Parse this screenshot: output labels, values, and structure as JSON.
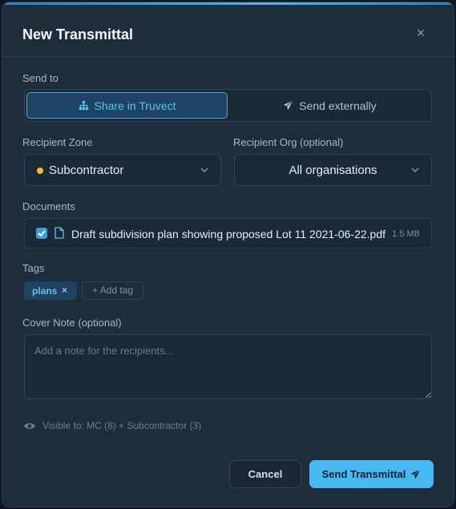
{
  "dialog": {
    "title": "New Transmittal",
    "close_glyph": "×"
  },
  "send_to": {
    "label": "Send to",
    "options": [
      {
        "label": "Share in Truvect",
        "icon": "sitemap-icon",
        "selected": true
      },
      {
        "label": "Send externally",
        "icon": "paper-plane-icon",
        "selected": false
      }
    ]
  },
  "recipient_zone": {
    "label": "Recipient Zone",
    "value": "Subcontractor",
    "dot_color": "#f5c02b"
  },
  "recipient_org": {
    "label": "Recipient Org (optional)",
    "value": "All organisations"
  },
  "documents": {
    "label": "Documents",
    "items": [
      {
        "name": "Draft subdivision plan showing proposed Lot 11 2021-06-22.pdf",
        "size": "1.5 MB",
        "checked": true
      }
    ]
  },
  "tags": {
    "label": "Tags",
    "items": [
      {
        "label": "plans",
        "remove_glyph": "×"
      }
    ],
    "add_label": "+ Add tag"
  },
  "cover_note": {
    "label": "Cover Note (optional)",
    "placeholder": "Add a note for the recipients...",
    "value": ""
  },
  "visibility": {
    "text": "Visible to: MC (8) + Subcontractor (3)"
  },
  "footer": {
    "cancel_label": "Cancel",
    "send_label": "Send Transmittal"
  },
  "colors": {
    "accent": "#48b8f2",
    "background": "#1e2c3b"
  }
}
